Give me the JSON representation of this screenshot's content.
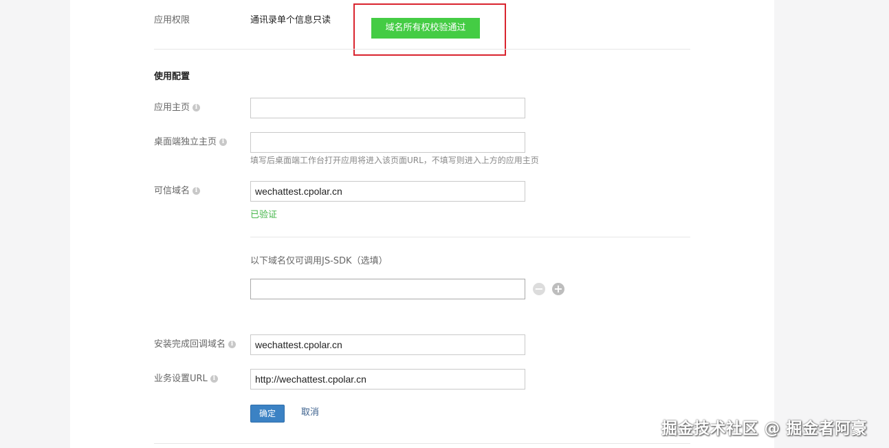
{
  "permission": {
    "label": "应用权限",
    "value": "通讯录单个信息只读",
    "verify_button": "域名所有权校验通过"
  },
  "config": {
    "section_title": "使用配置",
    "homepage": {
      "label": "应用主页",
      "value": ""
    },
    "desktop_homepage": {
      "label": "桌面端独立主页",
      "value": "",
      "hint": "填写后桌面端工作台打开应用将进入该页面URL，不填写则进入上方的应用主页"
    },
    "trusted_domain": {
      "label": "可信域名",
      "value": "wechattest.cpolar.cn",
      "status": "已验证"
    },
    "jssdk": {
      "label": "以下域名仅可调用JS-SDK（选填）",
      "value": ""
    },
    "install_callback": {
      "label": "安装完成回调域名",
      "value": "wechattest.cpolar.cn"
    },
    "business_url": {
      "label": "业务设置URL",
      "value": "http://wechattest.cpolar.cn"
    },
    "confirm_button": "确定",
    "cancel_link": "取消"
  },
  "icons": {
    "info": "info-icon",
    "minus": "minus-circle-icon",
    "plus": "plus-circle-icon"
  },
  "colors": {
    "verify_green": "#44cc44",
    "verified_text": "#44b549",
    "primary_blue": "#3b82c4",
    "highlight_red": "#d9232d"
  },
  "watermark": "掘金技术社区 @ 掘金者阿豪"
}
